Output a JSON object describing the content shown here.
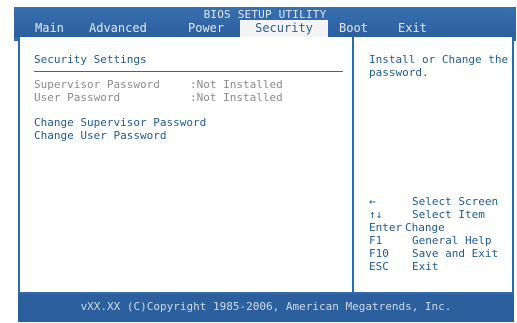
{
  "window": {
    "title": "BIOS SETUP UTILITY"
  },
  "menu": {
    "items": [
      {
        "label": "Main"
      },
      {
        "label": "Advanced"
      },
      {
        "label": "Power"
      },
      {
        "label": "Security"
      },
      {
        "label": "Boot"
      },
      {
        "label": "Exit"
      }
    ],
    "active": "Security"
  },
  "main": {
    "heading": "Security Settings",
    "status_rows": [
      {
        "label": "Supervisor Password",
        "value": ":Not Installed"
      },
      {
        "label": "User Password",
        "value": ":Not Installed"
      }
    ],
    "actions": [
      {
        "label": "Change Supervisor Password"
      },
      {
        "label": "Change User Password"
      }
    ]
  },
  "help": {
    "text_line1": "Install or Change the",
    "text_line2": "password.",
    "keys": [
      {
        "key": "←",
        "action": "Select Screen"
      },
      {
        "key": "↑↓",
        "action": "Select Item"
      },
      {
        "key": "Enter",
        "action": "Change"
      },
      {
        "key": "F1",
        "action": "General Help"
      },
      {
        "key": "F10",
        "action": "Save and Exit"
      },
      {
        "key": "ESC",
        "action": "Exit"
      }
    ]
  },
  "footer": {
    "copyright": "vXX.XX (C)Copyright 1985-2006, American Megatrends, Inc."
  },
  "colors": {
    "header_bg": "#2b5f9e",
    "border": "#2e6aad",
    "text_blue": "#1c5c96",
    "text_gray": "#8c8c8c",
    "active_tab_bg": "#f4f4f4"
  }
}
